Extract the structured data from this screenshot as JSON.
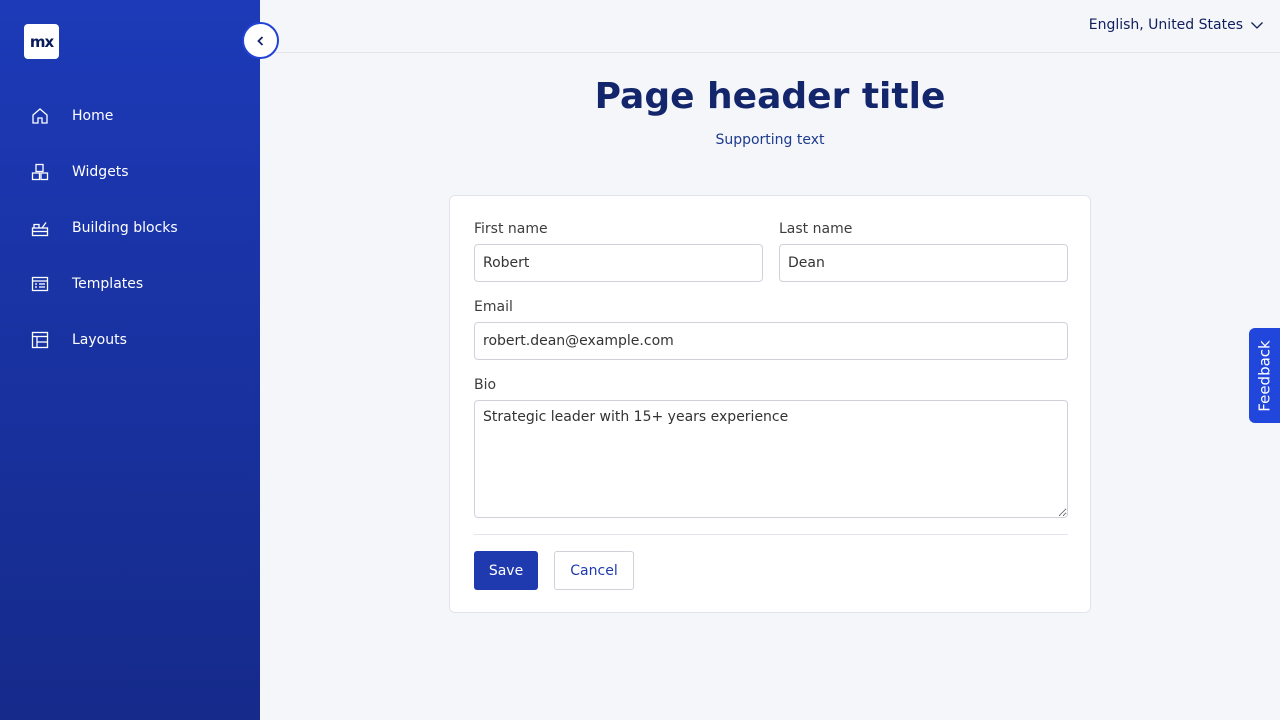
{
  "sidebar": {
    "logo_text": "mx",
    "items": [
      {
        "label": "Home",
        "icon": "home-icon"
      },
      {
        "label": "Widgets",
        "icon": "widgets-icon"
      },
      {
        "label": "Building blocks",
        "icon": "building-blocks-icon"
      },
      {
        "label": "Templates",
        "icon": "templates-icon"
      },
      {
        "label": "Layouts",
        "icon": "layouts-icon"
      }
    ],
    "collapse_icon": "chevron-left-icon"
  },
  "topbar": {
    "language": "English, United States",
    "language_icon": "chevron-down-icon"
  },
  "header": {
    "title": "Page header title",
    "subtitle": "Supporting text"
  },
  "form": {
    "first_name": {
      "label": "First name",
      "value": "Robert"
    },
    "last_name": {
      "label": "Last name",
      "value": "Dean"
    },
    "email": {
      "label": "Email",
      "value": "robert.dean@example.com"
    },
    "bio": {
      "label": "Bio",
      "value": "Strategic leader with 15+ years experience"
    },
    "save_label": "Save",
    "cancel_label": "Cancel"
  },
  "feedback": {
    "label": "Feedback"
  },
  "colors": {
    "sidebar_top": "#1d3ab8",
    "sidebar_bottom": "#152a8a",
    "primary": "#1f3aaf",
    "title": "#14266b",
    "feedback": "#2146dc"
  }
}
